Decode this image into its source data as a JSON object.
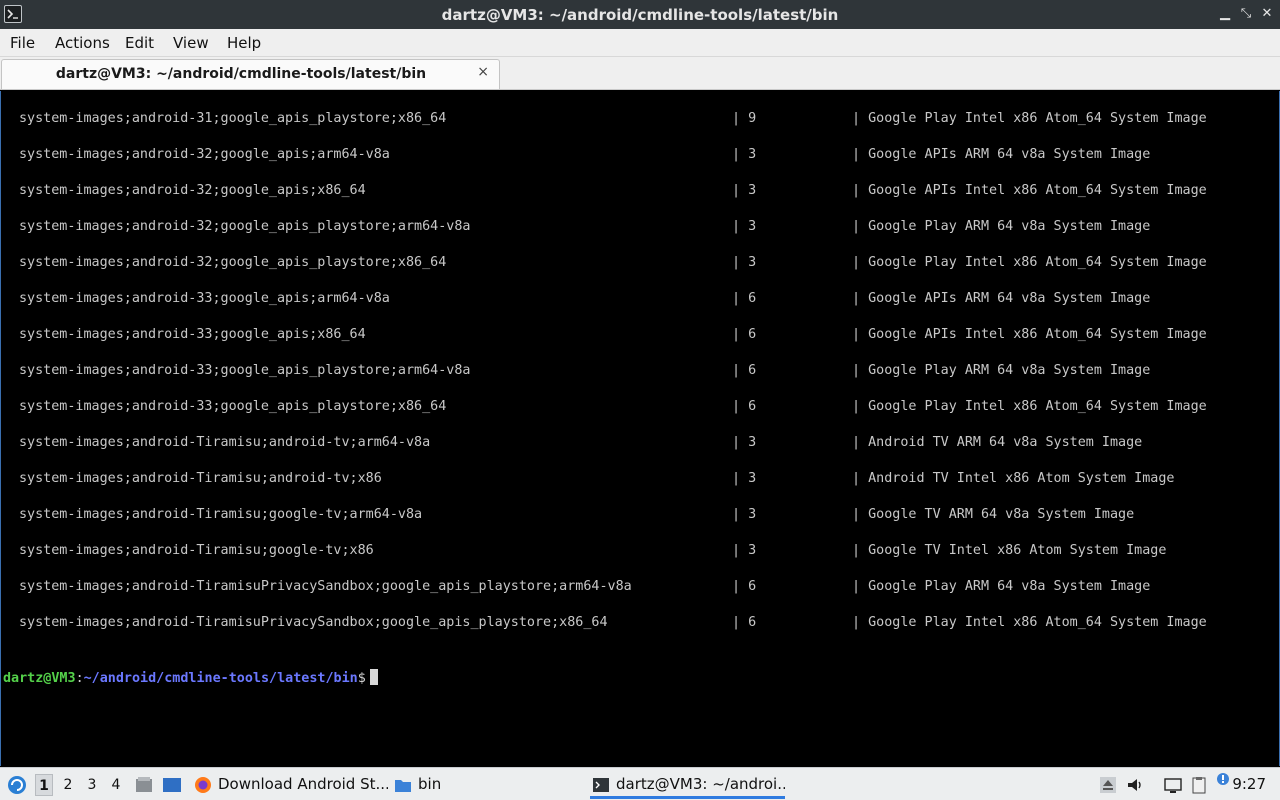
{
  "window": {
    "title": "dartz@VM3: ~/android/cmdline-tools/latest/bin"
  },
  "menu": [
    "File",
    "Actions",
    "Edit",
    "View",
    "Help"
  ],
  "tab": {
    "label": "dartz@VM3: ~/android/cmdline-tools/latest/bin",
    "close": "×"
  },
  "terminal": {
    "rows": [
      {
        "path": "system-images;android-31;google_apis_playstore;x86_64",
        "version": "| 9",
        "description": "| Google Play Intel x86 Atom_64 System Image"
      },
      {
        "path": "system-images;android-32;google_apis;arm64-v8a",
        "version": "| 3",
        "description": "| Google APIs ARM 64 v8a System Image"
      },
      {
        "path": "system-images;android-32;google_apis;x86_64",
        "version": "| 3",
        "description": "| Google APIs Intel x86 Atom_64 System Image"
      },
      {
        "path": "system-images;android-32;google_apis_playstore;arm64-v8a",
        "version": "| 3",
        "description": "| Google Play ARM 64 v8a System Image"
      },
      {
        "path": "system-images;android-32;google_apis_playstore;x86_64",
        "version": "| 3",
        "description": "| Google Play Intel x86 Atom_64 System Image"
      },
      {
        "path": "system-images;android-33;google_apis;arm64-v8a",
        "version": "| 6",
        "description": "| Google APIs ARM 64 v8a System Image"
      },
      {
        "path": "system-images;android-33;google_apis;x86_64",
        "version": "| 6",
        "description": "| Google APIs Intel x86 Atom_64 System Image"
      },
      {
        "path": "system-images;android-33;google_apis_playstore;arm64-v8a",
        "version": "| 6",
        "description": "| Google Play ARM 64 v8a System Image"
      },
      {
        "path": "system-images;android-33;google_apis_playstore;x86_64",
        "version": "| 6",
        "description": "| Google Play Intel x86 Atom_64 System Image"
      },
      {
        "path": "system-images;android-Tiramisu;android-tv;arm64-v8a",
        "version": "| 3",
        "description": "| Android TV ARM 64 v8a System Image"
      },
      {
        "path": "system-images;android-Tiramisu;android-tv;x86",
        "version": "| 3",
        "description": "| Android TV Intel x86 Atom System Image"
      },
      {
        "path": "system-images;android-Tiramisu;google-tv;arm64-v8a",
        "version": "| 3",
        "description": "| Google TV ARM 64 v8a System Image"
      },
      {
        "path": "system-images;android-Tiramisu;google-tv;x86",
        "version": "| 3",
        "description": "| Google TV Intel x86 Atom System Image"
      },
      {
        "path": "system-images;android-TiramisuPrivacySandbox;google_apis_playstore;arm64-v8a",
        "version": "| 6",
        "description": "| Google Play ARM 64 v8a System Image"
      },
      {
        "path": "system-images;android-TiramisuPrivacySandbox;google_apis_playstore;x86_64",
        "version": "| 6",
        "description": "| Google Play Intel x86 Atom_64 System Image"
      }
    ],
    "prompt": {
      "user": "dartz@VM3",
      "sep": ":",
      "path": "~/android/cmdline-tools/latest/bin",
      "symbol": "$"
    }
  },
  "taskbar": {
    "workspaces": [
      "1",
      "2",
      "3",
      "4"
    ],
    "tasks": [
      {
        "label": "Download Android St...",
        "icon": "firefox-icon"
      },
      {
        "label": "bin",
        "icon": "folder-icon"
      },
      {
        "label": "dartz@VM3: ~/androi...",
        "icon": "terminal-icon"
      }
    ],
    "clock": "9:27"
  },
  "colors": {
    "prompt_user": "#54d14a",
    "prompt_path": "#6b78ff",
    "active_task": "#2f7be0"
  }
}
